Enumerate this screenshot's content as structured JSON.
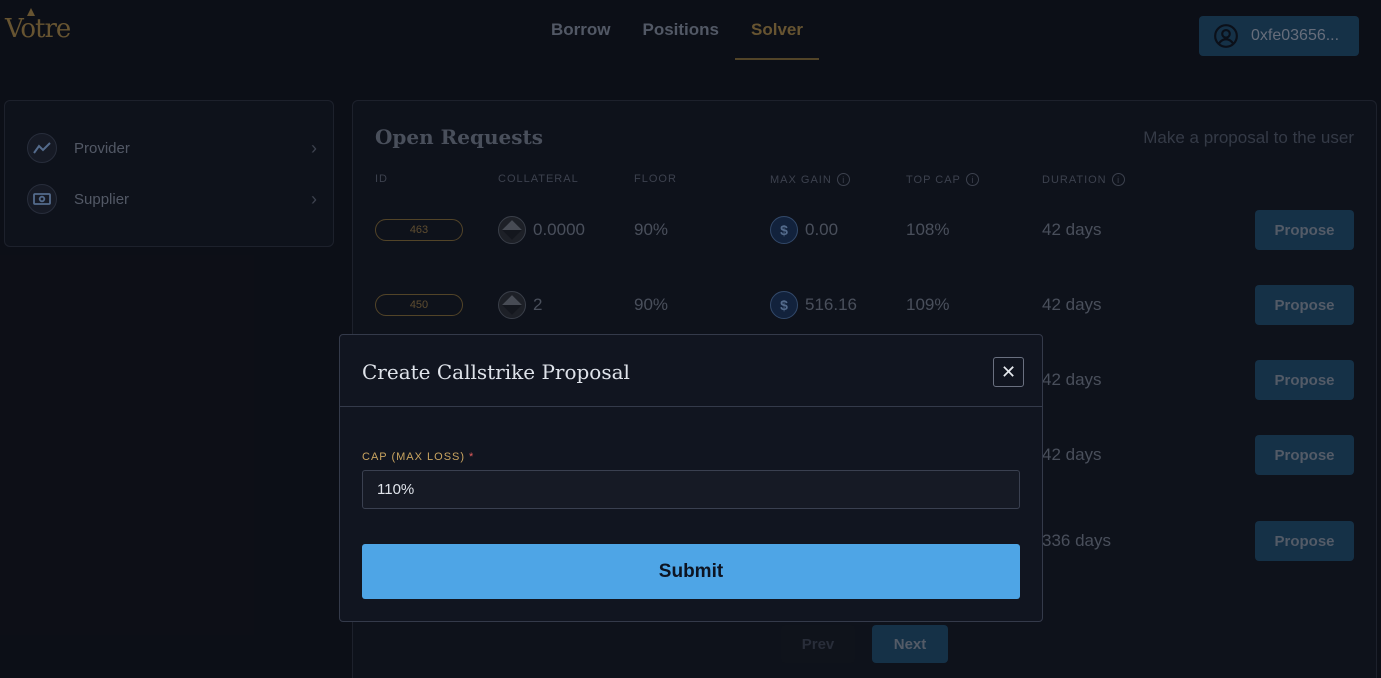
{
  "brand": {
    "logo_text": "Votre"
  },
  "nav": {
    "items": [
      {
        "label": "Borrow",
        "active": false
      },
      {
        "label": "Positions",
        "active": false
      },
      {
        "label": "Solver",
        "active": true
      }
    ]
  },
  "wallet": {
    "address": "0xfe03656...",
    "icon": "user-circle-icon"
  },
  "sidebar": {
    "items": [
      {
        "label": "Provider",
        "icon": "chart-line-icon"
      },
      {
        "label": "Supplier",
        "icon": "cash-icon"
      }
    ]
  },
  "panel": {
    "title": "Open Requests",
    "hint": "Make a proposal to the user",
    "columns": {
      "id": "ID",
      "collateral": "COLLATERAL",
      "floor": "FLOOR",
      "max_gain": "MAX GAIN",
      "top_cap": "TOP CAP",
      "duration": "DURATION"
    },
    "rows": [
      {
        "id": "463",
        "collateral": "0.0000",
        "floor": "90%",
        "max_gain": "0.00",
        "top_cap": "108%",
        "duration": "42 days",
        "action": "Propose"
      },
      {
        "id": "450",
        "collateral": "2",
        "floor": "90%",
        "max_gain": "516.16",
        "top_cap": "109%",
        "duration": "42 days",
        "action": "Propose"
      },
      {
        "duration": "42 days",
        "action": "Propose"
      },
      {
        "duration": "42 days",
        "action": "Propose"
      },
      {
        "duration": "336 days",
        "action": "Propose"
      }
    ],
    "pagination": {
      "prev": "Prev",
      "next": "Next"
    }
  },
  "modal": {
    "title": "Create Callstrike Proposal",
    "field_label": "CAP (MAX LOSS)",
    "required_mark": "*",
    "field_value": "110%",
    "submit_label": "Submit",
    "close_symbol": "✕"
  },
  "colors": {
    "background": "#10131c",
    "accent_gold": "#9c7d44",
    "button_blue": "#1e4766",
    "submit_blue": "#4ea5e6"
  }
}
